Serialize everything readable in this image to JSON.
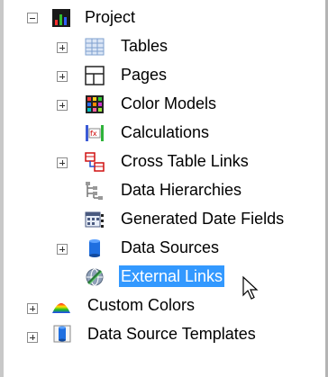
{
  "tree": {
    "root": {
      "label": "Project",
      "icon": "project-chart-icon",
      "expanded": true
    },
    "children": [
      {
        "label": "Tables",
        "icon": "table-grid-icon",
        "expandable": true
      },
      {
        "label": "Pages",
        "icon": "pages-icon",
        "expandable": true
      },
      {
        "label": "Color Models",
        "icon": "color-models-icon",
        "expandable": true
      },
      {
        "label": "Calculations",
        "icon": "calculations-icon",
        "expandable": false
      },
      {
        "label": "Cross Table Links",
        "icon": "cross-table-links-icon",
        "expandable": true
      },
      {
        "label": "Data Hierarchies",
        "icon": "data-hierarchies-icon",
        "expandable": false
      },
      {
        "label": "Generated Date Fields",
        "icon": "generated-date-fields-icon",
        "expandable": false
      },
      {
        "label": "Data Sources",
        "icon": "data-sources-icon",
        "expandable": true
      },
      {
        "label": "External Links",
        "icon": "external-links-icon",
        "expandable": false,
        "selected": true
      }
    ],
    "siblings": [
      {
        "label": "Custom Colors",
        "icon": "custom-colors-icon",
        "expandable": true
      },
      {
        "label": "Data Source Templates",
        "icon": "data-source-templates-icon",
        "expandable": true
      }
    ]
  },
  "colors": {
    "selection": "#3399ff",
    "selected_text": "#ffffff"
  }
}
